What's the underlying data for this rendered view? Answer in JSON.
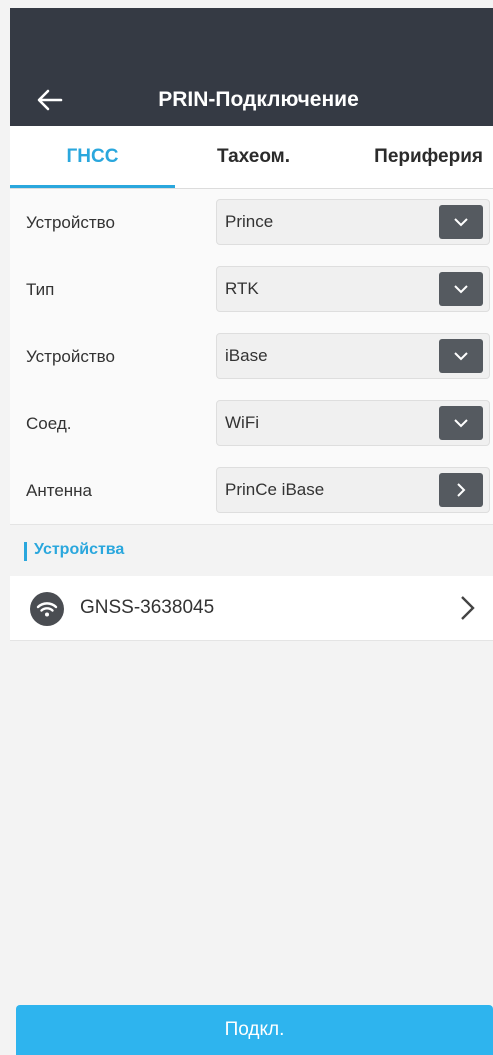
{
  "header": {
    "title": "PRIN-Подключение",
    "back_icon": "arrow-left-icon"
  },
  "tabs": [
    {
      "label": "ГНСС",
      "active": true
    },
    {
      "label": "Тахеом.",
      "active": false
    },
    {
      "label": "Периферия",
      "active": false
    }
  ],
  "settings": [
    {
      "label": "Устройство",
      "value": "Prince",
      "control": "dropdown"
    },
    {
      "label": "Тип",
      "value": "RTK",
      "control": "dropdown"
    },
    {
      "label": "Устройство",
      "value": "iBase",
      "control": "dropdown"
    },
    {
      "label": "Соед.",
      "value": "WiFi",
      "control": "dropdown"
    },
    {
      "label": "Антенна",
      "value": "PrinCe iBase",
      "control": "navigate"
    }
  ],
  "devices_section": {
    "title": "Устройства"
  },
  "devices": [
    {
      "name": "GNSS-3638045",
      "icon": "wifi-icon"
    }
  ],
  "connect_button": {
    "label": "Подкл."
  },
  "colors": {
    "accent": "#2aa7dd",
    "appbar": "#353a44",
    "button": "#2eb4ee"
  }
}
